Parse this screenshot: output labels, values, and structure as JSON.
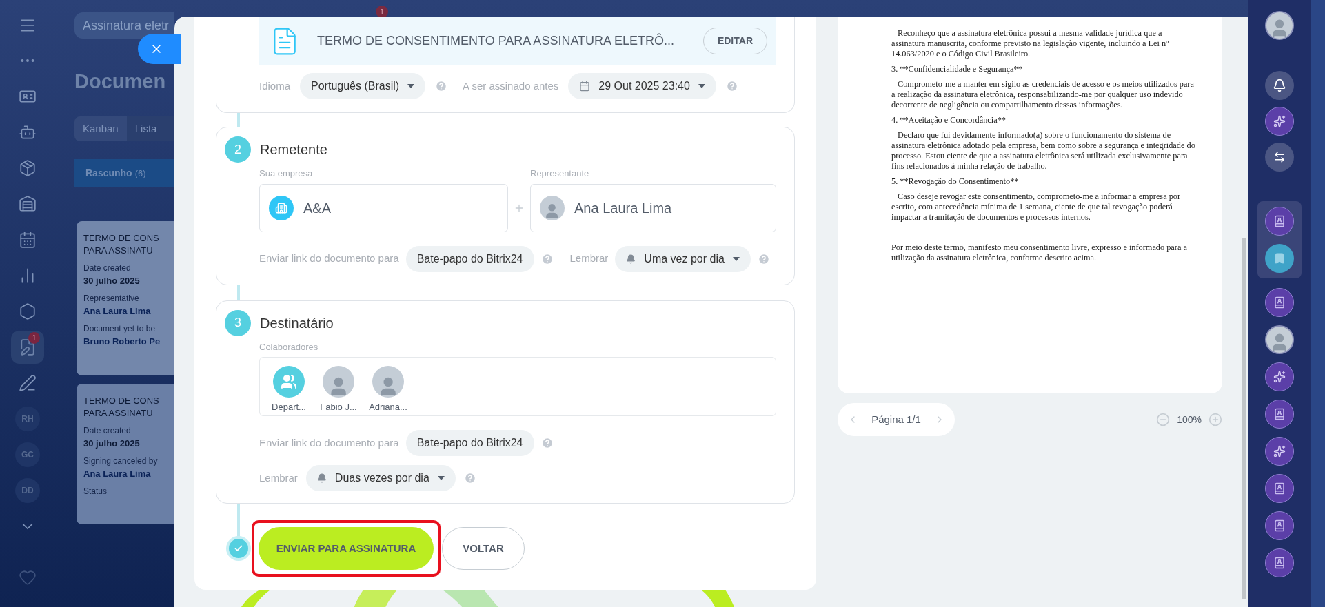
{
  "top_bar": {
    "search": {
      "value": "Assinatura eletr"
    },
    "badge": "1"
  },
  "left_nav": [
    {
      "kind": "menu",
      "selected": false
    },
    {
      "kind": "apps",
      "selected": false
    },
    {
      "kind": "contact",
      "selected": false
    },
    {
      "kind": "robot",
      "selected": false
    },
    {
      "kind": "box",
      "selected": false
    },
    {
      "kind": "warehouse",
      "selected": false
    },
    {
      "kind": "calendar",
      "selected": false
    },
    {
      "kind": "chart",
      "selected": false
    },
    {
      "kind": "hexagon",
      "selected": false
    },
    {
      "kind": "sign",
      "selected": true,
      "badge": "1"
    },
    {
      "kind": "pen",
      "selected": false
    },
    {
      "kind": "initials",
      "label": "RH",
      "selected": false
    },
    {
      "kind": "initials",
      "label": "GC",
      "selected": false
    },
    {
      "kind": "initials",
      "label": "DD",
      "selected": false
    },
    {
      "kind": "more",
      "selected": false
    },
    {
      "kind": "heart",
      "selected": false
    }
  ],
  "background_page": {
    "title": "Documen",
    "tabs": [
      {
        "label": "Kanban",
        "selected": true
      },
      {
        "label": "Lista",
        "selected": false
      }
    ],
    "column": {
      "title": "Rascunho",
      "count": "(6)"
    },
    "cards": [
      {
        "title_lines": [
          "TERMO DE CONS",
          "PARA ASSINATU"
        ],
        "fields": [
          {
            "label": "Date created",
            "value": "30 julho 2025",
            "kind": "date"
          },
          {
            "label": "Representative",
            "value": "Ana Laura Lima",
            "kind": "person"
          },
          {
            "label": "Document yet to be",
            "value": "Bruno Roberto Pe",
            "kind": "person"
          }
        ]
      },
      {
        "title_lines": [
          "TERMO DE CONS",
          "PARA ASSINATU"
        ],
        "fields": [
          {
            "label": "Date created",
            "value": "30 julho 2025",
            "kind": "date"
          },
          {
            "label": "Signing canceled by",
            "value": "Ana Laura Lima",
            "kind": "person"
          },
          {
            "label": "Status"
          }
        ]
      }
    ]
  },
  "wizard": {
    "document": {
      "title": "TERMO DE CONSENTIMENTO PARA ASSINATURA ELETRÔ...",
      "edit_button": "EDITAR",
      "language_label": "Idioma",
      "language": "Português (Brasil)",
      "deadline_label": "A ser assinado antes",
      "deadline": "29 Out 2025 23:40"
    },
    "sender": {
      "step": "2",
      "title": "Remetente",
      "company_label": "Sua empresa",
      "company": "A&A",
      "representative_label": "Representante",
      "representative": "Ana Laura Lima",
      "link_label": "Enviar link do documento para",
      "link_channel": "Bate-papo do Bitrix24",
      "remind_label": "Lembrar",
      "remind": "Uma vez por dia"
    },
    "recipient": {
      "step": "3",
      "title": "Destinatário",
      "collaborators_label": "Colaboradores",
      "collaborators": [
        {
          "kind": "department",
          "name": "Depart..."
        },
        {
          "kind": "person",
          "name": "Fabio J..."
        },
        {
          "kind": "person",
          "name": "Adriana..."
        }
      ],
      "link_label": "Enviar link do documento para",
      "link_channel": "Bate-papo do Bitrix24",
      "remind_label": "Lembrar",
      "remind": "Duas vezes por dia"
    },
    "actions": {
      "submit": "ENVIAR PARA ASSINATURA",
      "back": "VOLTAR",
      "highlighted": true
    }
  },
  "preview": {
    "paragraphs": [
      {
        "kind": "body",
        "text": "Reconheço que a assinatura eletrônica possui a mesma validade jurídica que a assinatura manuscrita, conforme previsto na legislação vigente, incluindo a Lei nº 14.063/2020 e o Código Civil Brasileiro."
      },
      {
        "kind": "heading",
        "text": "3. **Confidencialidade e Segurança**"
      },
      {
        "kind": "body",
        "text": "Comprometo-me a manter em sigilo as credenciais de acesso e os meios utilizados para a realização da assinatura eletrônica, responsabilizando-me por qualquer uso indevido decorrente de negligência ou compartilhamento dessas informações."
      },
      {
        "kind": "heading",
        "text": "4. **Aceitação e Concordância**"
      },
      {
        "kind": "body",
        "text": "Declaro que fui devidamente informado(a) sobre o funcionamento do sistema de assinatura eletrônica adotado pela empresa, bem como sobre a segurança e integridade do processo. Estou ciente de que a assinatura eletrônica será utilizada exclusivamente para fins relacionados à minha relação de trabalho."
      },
      {
        "kind": "heading",
        "text": "5. **Revogação do Consentimento**"
      },
      {
        "kind": "body",
        "text": "Caso deseje revogar este consentimento, comprometo-me a informar a empresa por escrito, com antecedência mínima de 1 semana, ciente de que tal revogação poderá impactar a tramitação de documentos e processos internos."
      },
      {
        "kind": "closing",
        "text": "Por meio deste termo, manifesto meu consentimento livre, expresso e informado para a utilização da assinatura eletrônica, conforme descrito acima."
      }
    ],
    "pager": "Página 1/1",
    "zoom": "100%"
  },
  "right_rail": {
    "top": [
      {
        "kind": "avatar"
      },
      {
        "kind": "bell"
      },
      {
        "kind": "sparkle"
      },
      {
        "kind": "exchange"
      }
    ],
    "pinned": [
      {
        "kind": "book",
        "selected": false
      },
      {
        "kind": "bookmark",
        "selected": true
      }
    ],
    "chats": [
      {
        "kind": "book"
      },
      {
        "kind": "avatar"
      },
      {
        "kind": "sparkle"
      },
      {
        "kind": "book"
      },
      {
        "kind": "sparkle"
      },
      {
        "kind": "book"
      },
      {
        "kind": "book"
      },
      {
        "kind": "book"
      }
    ]
  }
}
